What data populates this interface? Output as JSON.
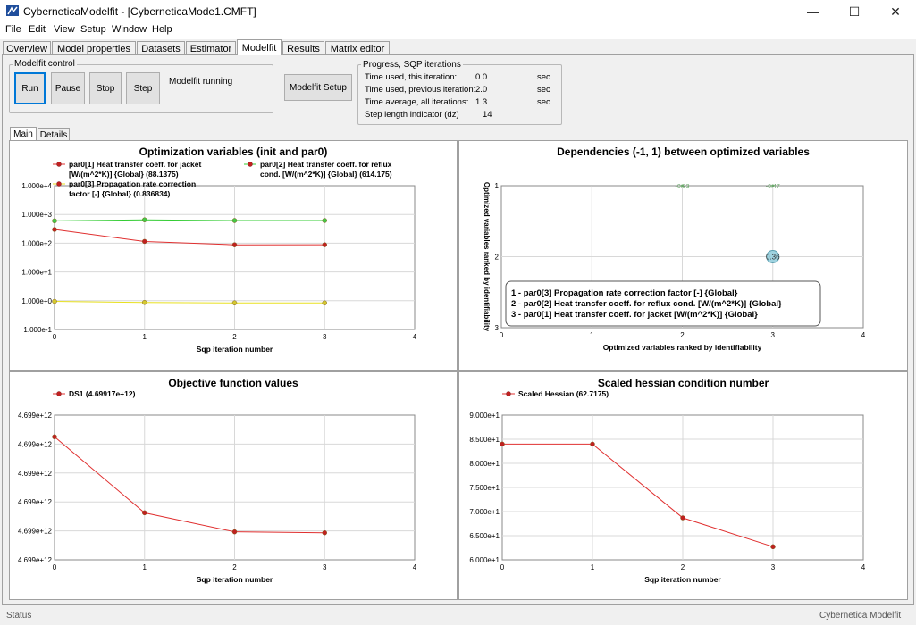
{
  "window": {
    "title": "CyberneticaModelfit - [CyberneticaMode1.CMFT]",
    "minimize": "—",
    "maximize": "☐",
    "close": "✕"
  },
  "menu": [
    "File",
    "Edit",
    "View",
    "Setup",
    "Window",
    "Help"
  ],
  "tabs": [
    "Overview",
    "Model properties",
    "Datasets",
    "Estimator",
    "Modelfit",
    "Results",
    "Matrix editor"
  ],
  "active_tab": "Modelfit",
  "control": {
    "group_label": "Modelfit control",
    "run": "Run",
    "pause": "Pause",
    "stop": "Stop",
    "step": "Step",
    "status": "Modelfit running",
    "setup": "Modelfit Setup"
  },
  "progress": {
    "group_label": "Progress, SQP iterations",
    "rows": [
      {
        "label": "Time used, this iteration:",
        "value": "0.0",
        "unit": "sec"
      },
      {
        "label": "Time used, previous iteration:",
        "value": "2.0",
        "unit": "sec"
      },
      {
        "label": "Time average, all iterations:",
        "value": "1.3",
        "unit": "sec"
      },
      {
        "label": "Step length indicator (dz)",
        "value": "14",
        "unit": ""
      }
    ]
  },
  "subtabs": [
    "Main",
    "Details"
  ],
  "status_left": "Status",
  "status_right": "Cybernetica Modelfit",
  "chart_data": [
    {
      "type": "line",
      "title": "Optimization variables (init and par0)",
      "xlabel": "Sqp iteration number",
      "ylabel": "",
      "xlim": [
        0,
        4
      ],
      "ylim": [
        0.1,
        10000
      ],
      "log_y": true,
      "xticks": [
        "0",
        "1",
        "2",
        "3",
        "4"
      ],
      "yticks": [
        "1.000e-1",
        "1.000e+0",
        "1.000e+1",
        "1.000e+2",
        "1.000e+3",
        "1.000e+4"
      ],
      "legend": [
        "par0[1] Heat transfer coeff. for jacket [W/(m^2*K)] {Global} (88.1375)",
        "par0[2] Heat transfer coeff. for reflux cond. [W/(m^2*K)] {Global} (614.175)",
        "par0[3] Propagation rate correction factor [-] {Global} (0.836834)"
      ],
      "series": [
        {
          "color": "#e03030",
          "x": [
            0,
            1,
            2,
            3
          ],
          "y": [
            300,
            115,
            88,
            88.1375
          ]
        },
        {
          "color": "#33cc33",
          "x": [
            0,
            1,
            2,
            3
          ],
          "y": [
            600,
            650,
            614,
            614.175
          ]
        },
        {
          "color": "#e8e020",
          "x": [
            0,
            1,
            2,
            3
          ],
          "y": [
            0.95,
            0.87,
            0.84,
            0.836834
          ]
        }
      ]
    },
    {
      "type": "scatter",
      "title": "Dependencies (-1, 1) between optimized variables",
      "xlabel": "Optimized variables ranked by identifiability",
      "ylabel": "Optimized variables ranked by identifiability",
      "xlim": [
        0,
        4
      ],
      "ylim": [
        3,
        1
      ],
      "xticks": [
        "0",
        "1",
        "2",
        "3",
        "4"
      ],
      "yticks": [
        "1",
        "2",
        "3"
      ],
      "points": [
        {
          "x": 2,
          "y": 1,
          "label": "-0.93"
        },
        {
          "x": 3,
          "y": 1,
          "label": "-0.47"
        },
        {
          "x": 3,
          "y": 2,
          "label": "0.36"
        }
      ],
      "legend": [
        "1 - par0[3] Propagation rate correction factor [-] {Global}",
        "2 - par0[2] Heat transfer coeff. for reflux cond. [W/(m^2*K)] {Global}",
        "3 - par0[1] Heat transfer coeff. for jacket [W/(m^2*K)] {Global}"
      ]
    },
    {
      "type": "line",
      "title": "Objective function values",
      "xlabel": "Sqp iteration number",
      "ylabel": "",
      "xlim": [
        0,
        4
      ],
      "ylim": [
        0,
        6
      ],
      "xticks": [
        "0",
        "1",
        "2",
        "3",
        "4"
      ],
      "yticks": [
        "4.699e+12",
        "4.699e+12",
        "4.699e+12",
        "4.699e+12",
        "4.699e+12",
        "4.699e+12"
      ],
      "legend": [
        "DS1 (4.69917e+12)"
      ],
      "series": [
        {
          "color": "#e03030",
          "x": [
            0,
            1,
            2,
            3
          ],
          "y": [
            5.1,
            1.95,
            1.16,
            1.12
          ]
        }
      ]
    },
    {
      "type": "line",
      "title": "Scaled hessian condition number",
      "xlabel": "Sqp iteration number",
      "ylabel": "",
      "xlim": [
        0,
        4
      ],
      "ylim": [
        60,
        90
      ],
      "xticks": [
        "0",
        "1",
        "2",
        "3",
        "4"
      ],
      "yticks": [
        "6.000e+1",
        "6.500e+1",
        "7.000e+1",
        "7.500e+1",
        "8.000e+1",
        "8.500e+1",
        "9.000e+1"
      ],
      "legend": [
        "Scaled Hessian (62.7175)"
      ],
      "series": [
        {
          "color": "#e03030",
          "x": [
            0,
            1,
            2,
            3
          ],
          "y": [
            84,
            84,
            68.7,
            62.7175
          ]
        }
      ]
    }
  ]
}
